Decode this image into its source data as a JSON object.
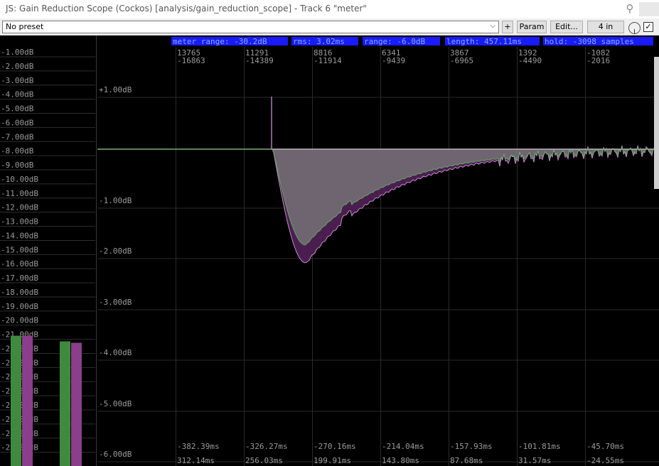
{
  "window": {
    "title": "JS: Gain Reduction Scope (Cockos) [analysis/gain_reduction_scope] - Track 6 \"meter\""
  },
  "toolbar": {
    "preset": "No preset",
    "add_label": "+",
    "param_label": "Param",
    "edit_label": "Edit...",
    "io_label": "4 in",
    "bypass_checked": true
  },
  "status": {
    "meter_range": "meter range: -30.2dB",
    "rms": "rms: 3.02ms",
    "range": "range: -6.0dB",
    "length": "length: 457.11ms",
    "hold": "hold: -3098 samples"
  },
  "meter_scale": [
    "-1.00dB",
    "-2.00dB",
    "-3.00dB",
    "-4.00dB",
    "-5.00dB",
    "-6.00dB",
    "-7.00dB",
    "-8.00dB",
    "-9.00dB",
    "-10.00dB",
    "-11.00dB",
    "-12.00dB",
    "-13.00dB",
    "-14.00dB",
    "-15.00dB",
    "-16.00dB",
    "-17.00dB",
    "-18.00dB",
    "-19.00dB",
    "-20.00dB",
    "-21.00dB",
    "-22.00dB",
    "-23.00dB",
    "-24.00dB",
    "-25.00dB",
    "-26.00dB",
    "-27.00dB",
    "-28.00dB",
    "-29.00dB"
  ],
  "meter_bars": [
    {
      "name": "input-left",
      "color": "#3f8a3f",
      "level_db": -21.1
    },
    {
      "name": "output-left",
      "color": "#8a3f8a",
      "level_db": -21.1
    },
    {
      "name": "input-right",
      "color": "#3f8a3f",
      "level_db": -21.5
    },
    {
      "name": "output-right",
      "color": "#8a3f8a",
      "level_db": -21.6
    }
  ],
  "scope_db_labels": [
    "+1.00dB",
    "-1.00dB",
    "-2.00dB",
    "-3.00dB",
    "-4.00dB",
    "-5.00dB",
    "-6.00dB"
  ],
  "sample_markers": [
    {
      "a": "13765",
      "b": "-16863"
    },
    {
      "a": "11291",
      "b": "-14389"
    },
    {
      "a": "8816",
      "b": "-11914"
    },
    {
      "a": "6341",
      "b": "-9439"
    },
    {
      "a": "3867",
      "b": "-6965"
    },
    {
      "a": "1392",
      "b": "-4490"
    },
    {
      "a": "-1082",
      "b": "-2016"
    }
  ],
  "time_markers_neg": [
    "-382.39ms",
    "-326.27ms",
    "-270.16ms",
    "-214.04ms",
    "-157.93ms",
    "-101.81ms",
    "-45.70ms"
  ],
  "time_markers_pos": [
    "312.14ms",
    "256.03ms",
    "199.91ms",
    "143.80ms",
    "87.68ms",
    "31.57ms",
    "-24.55ms"
  ],
  "colors": {
    "reference_line": "#b9b5ba",
    "fill": "#6e6570",
    "output_trace": "#c88ccf",
    "input_trace": "#5faa5a",
    "output_fill": "#4a1f50",
    "status_bg": "#1a1aff",
    "status_text": "#7fb0ff"
  }
}
